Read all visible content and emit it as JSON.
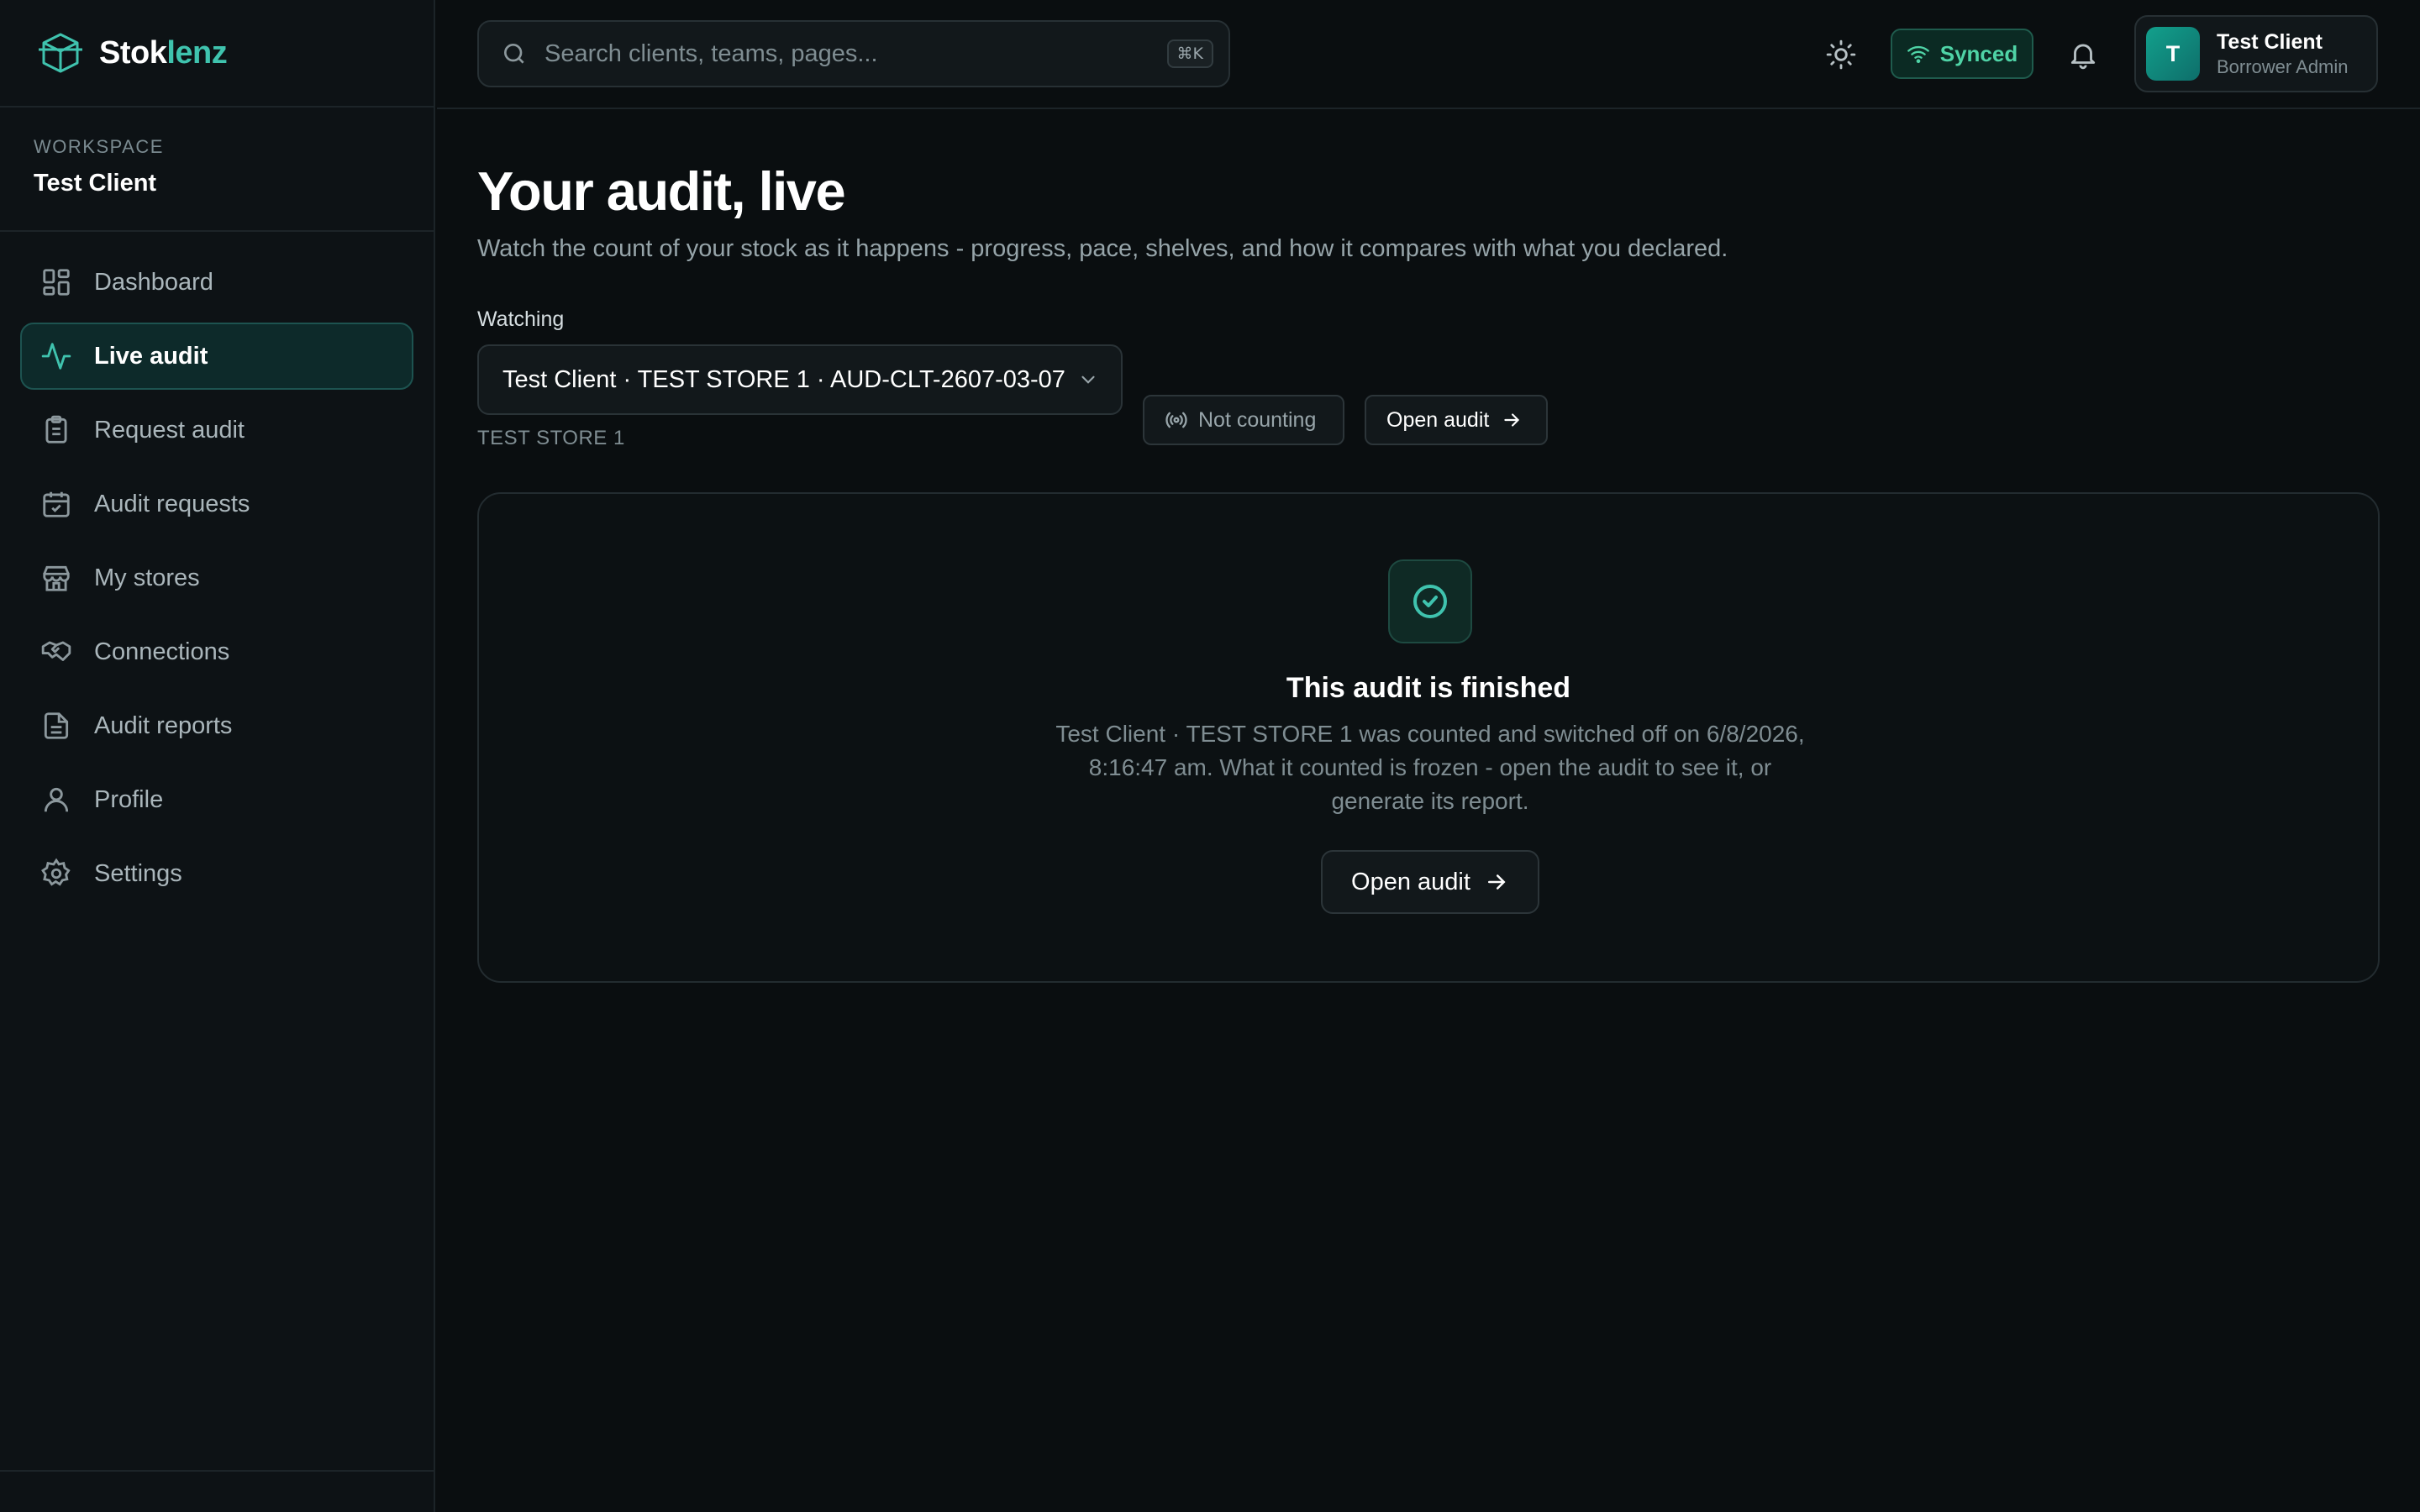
{
  "brand": {
    "name_main": "Stok",
    "name_accent": "lenz"
  },
  "workspace": {
    "label": "WORKSPACE",
    "name": "Test Client"
  },
  "sidebar": {
    "items": [
      {
        "label": "Dashboard",
        "icon": "dashboard-icon",
        "active": false
      },
      {
        "label": "Live audit",
        "icon": "activity-icon",
        "active": true
      },
      {
        "label": "Request audit",
        "icon": "clipboard-list-icon",
        "active": false
      },
      {
        "label": "Audit requests",
        "icon": "calendar-check-icon",
        "active": false
      },
      {
        "label": "My stores",
        "icon": "store-icon",
        "active": false
      },
      {
        "label": "Connections",
        "icon": "handshake-icon",
        "active": false
      },
      {
        "label": "Audit reports",
        "icon": "file-text-icon",
        "active": false
      },
      {
        "label": "Profile",
        "icon": "user-icon",
        "active": false
      },
      {
        "label": "Settings",
        "icon": "gear-icon",
        "active": false
      }
    ]
  },
  "topbar": {
    "search": {
      "placeholder": "Search clients, teams, pages...",
      "shortcut": "⌘K"
    },
    "sync_status": "Synced",
    "user": {
      "initial": "T",
      "name": "Test Client",
      "role": "Borrower Admin"
    }
  },
  "page": {
    "title": "Your audit, live",
    "subtitle": "Watch the count of your stock as it happens - progress, pace, shelves, and how it compares with what you declared.",
    "watching_label": "Watching",
    "selected_audit": "Test Client · TEST STORE 1 · AUD-CLT-2607-03-07",
    "selected_store": "TEST STORE 1",
    "counting_status": "Not counting",
    "open_audit_label": "Open audit"
  },
  "finished_card": {
    "title": "This audit is finished",
    "body": "Test Client · TEST STORE 1 was counted and switched off on 6/8/2026, 8:16:47 am. What it counted is frozen - open the audit to see it, or generate its report.",
    "button_label": "Open audit"
  },
  "colors": {
    "accent": "#3fc3ae",
    "synced": "#4fd3a6",
    "background": "#0a0e10",
    "sidebar": "#0d1215"
  }
}
